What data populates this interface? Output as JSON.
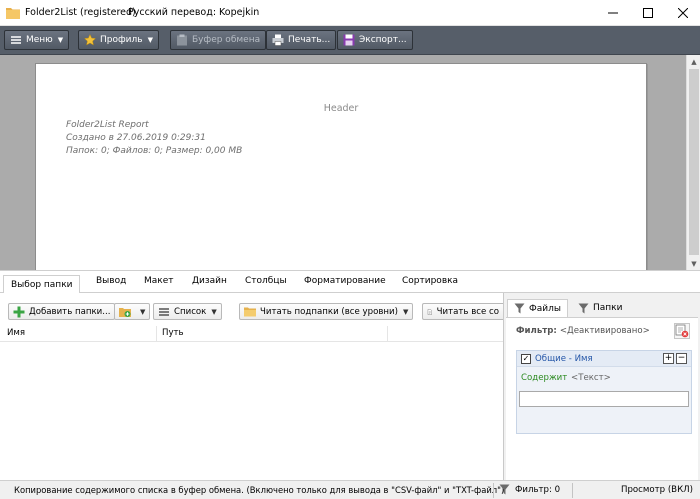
{
  "window": {
    "title": "Folder2List (registered)",
    "translation": "Русский перевод: Kopejkin"
  },
  "toolbar": {
    "menu": "Меню",
    "profile": "Профиль",
    "clipboard": "Буфер обмена",
    "print": "Печать...",
    "export": "Экспорт..."
  },
  "preview": {
    "header": "Header",
    "report_title": "Folder2List Report",
    "created": "Создано в 27.06.2019 0:29:31",
    "stats": "Папок: 0;   Файлов: 0;   Размер: 0,00 MB"
  },
  "tabs": [
    "Выбор папки",
    "Вывод",
    "Макет",
    "Дизайн",
    "Столбцы",
    "Форматирование",
    "Сортировка"
  ],
  "folder_pane": {
    "add_folders": "Добавить папки...",
    "list": "Список",
    "read_subfolders": "Читать подпапки (все уровни)",
    "read_all": "Читать все со",
    "columns": [
      "Имя",
      "Путь"
    ]
  },
  "filter_pane": {
    "tab_files": "Файлы",
    "tab_folders": "Папки",
    "filter_label": "Фильтр:",
    "filter_value": "<Деактивировано>",
    "group_title": "Общие - Имя",
    "condition_key": "Содержит",
    "condition_value": "<Текст>",
    "input_value": ""
  },
  "status": {
    "message": "Копирование содержимого списка в буфер обмена. (Включено только для вывода в \"CSV-файл\" и \"TXT-файл\")",
    "filter": "Фильтр: 0",
    "preview": "Просмотр (ВКЛ)"
  },
  "colors": {
    "toolbar_bg": "#565e69",
    "preview_bg": "#ababab",
    "accent_blue": "#2456a8",
    "condition_green": "#2b8a20"
  }
}
